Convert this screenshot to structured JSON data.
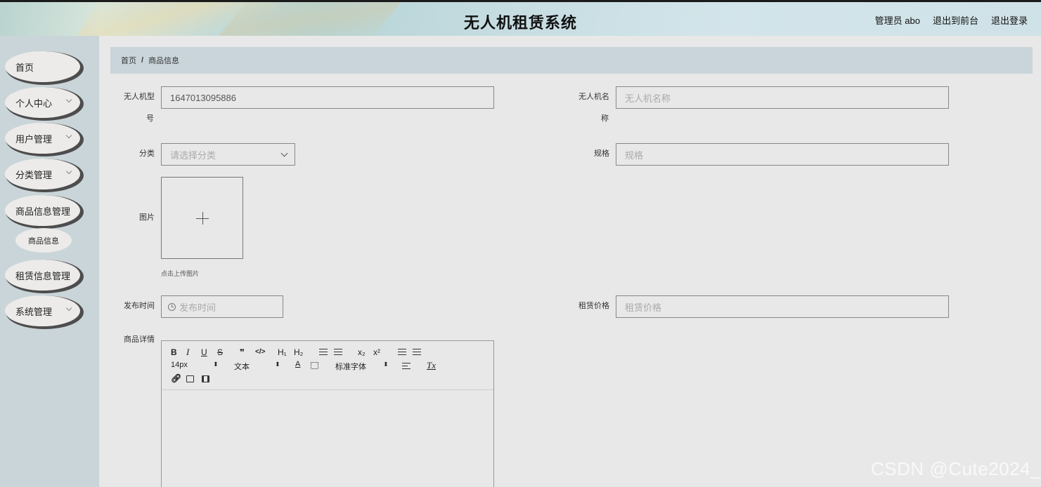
{
  "header": {
    "title": "无人机租赁系统",
    "admin_label": "管理员 abo",
    "front_link": "退出到前台",
    "logout_link": "退出登录"
  },
  "sidebar": {
    "items": [
      {
        "label": "首页"
      },
      {
        "label": "个人中心"
      },
      {
        "label": "用户管理"
      },
      {
        "label": "分类管理"
      },
      {
        "label": "商品信息管理"
      },
      {
        "label": "租赁信息管理"
      },
      {
        "label": "系统管理"
      }
    ],
    "sub_item": "商品信息"
  },
  "breadcrumb": {
    "home": "首页",
    "separator": "/",
    "current": "商品信息"
  },
  "form": {
    "model_label_1": "无人机型",
    "model_label_2": "号",
    "model_value": "1647013095886",
    "name_label_1": "无人机名",
    "name_label_2": "称",
    "name_placeholder": "无人机名称",
    "category_label": "分类",
    "category_placeholder": "请选择分类",
    "spec_label": "规格",
    "spec_placeholder": "规格",
    "image_label": "图片",
    "upload_hint": "点击上传图片",
    "publish_label": "发布时间",
    "publish_placeholder": "发布时间",
    "price_label": "租赁价格",
    "price_placeholder": "租赁价格",
    "detail_label": "商品详情"
  },
  "editor": {
    "bold": "B",
    "italic": "I",
    "underline": "U",
    "strike": "S",
    "quote": "❞",
    "code": "</>",
    "h1": "H₁",
    "h2": "H₂",
    "sub": "x₂",
    "sup": "x²",
    "size": "14px",
    "text_type": "文本",
    "font_color": "A",
    "font": "标准字体",
    "clear": "Tx"
  },
  "watermark": "CSDN @Cute2024_"
}
